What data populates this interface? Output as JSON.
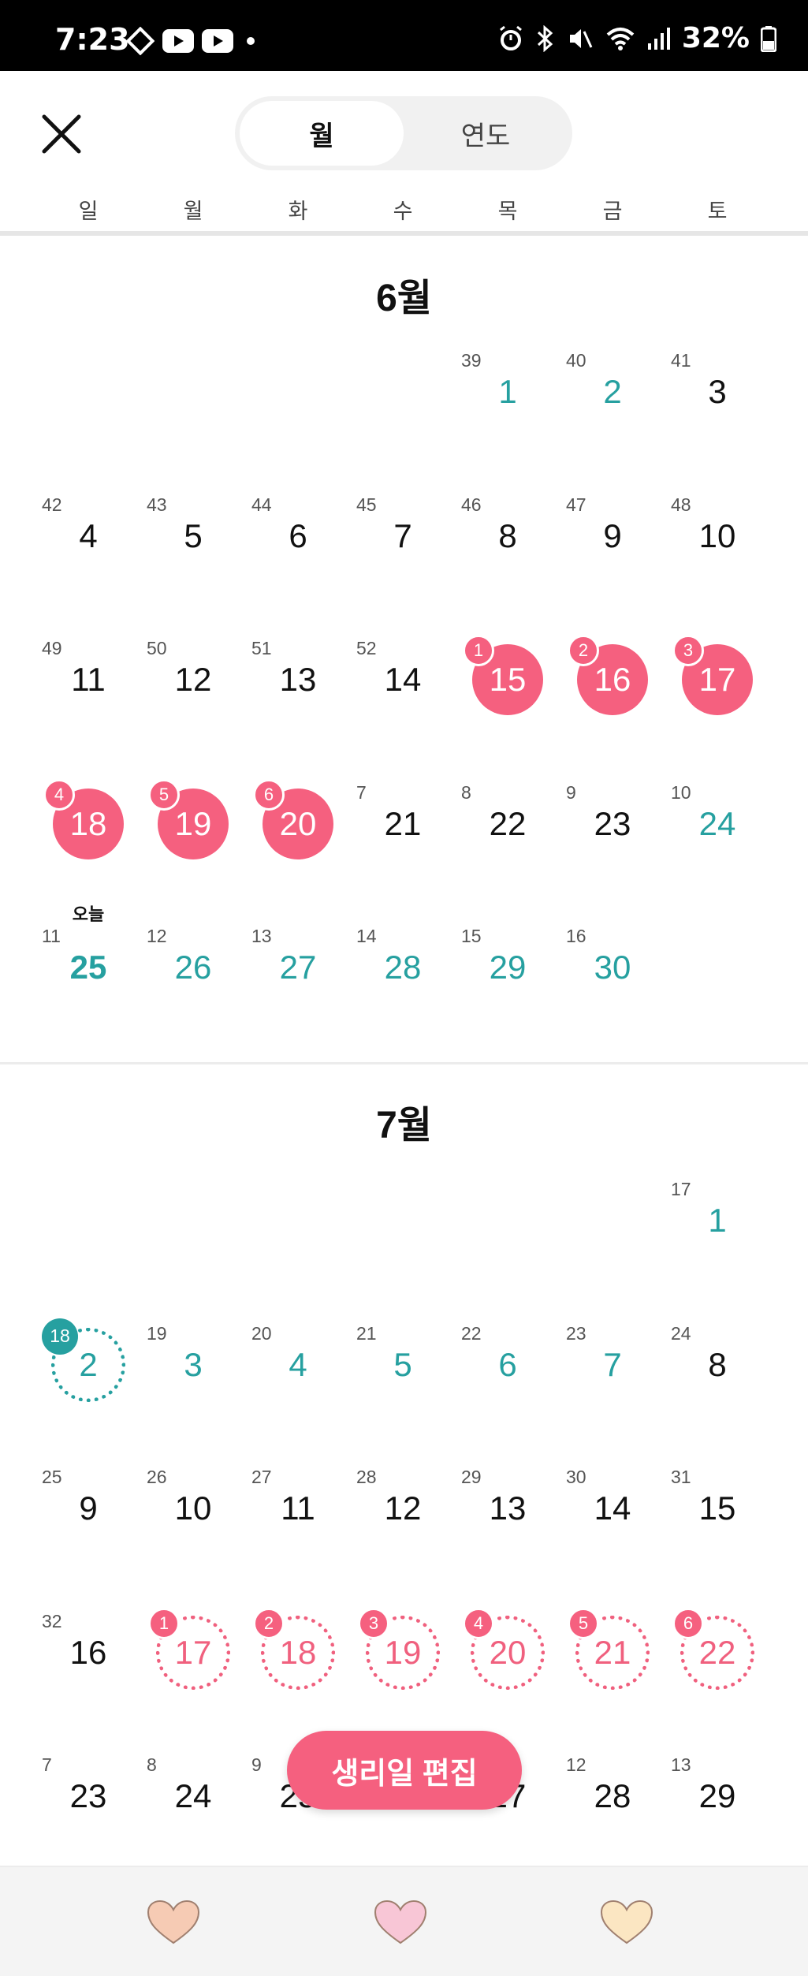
{
  "status_bar": {
    "time": "7:23",
    "battery": "32%"
  },
  "header": {
    "tabs": [
      {
        "label": "월",
        "active": true
      },
      {
        "label": "연도",
        "active": false
      }
    ],
    "weekdays": [
      "일",
      "월",
      "화",
      "수",
      "목",
      "금",
      "토"
    ]
  },
  "months": [
    {
      "title": "6월",
      "today_label": "오늘",
      "weeks": [
        [
          null,
          null,
          null,
          null,
          {
            "day": "1",
            "cycle": "39",
            "style": "teal"
          },
          {
            "day": "2",
            "cycle": "40",
            "style": "teal"
          },
          {
            "day": "3",
            "cycle": "41",
            "style": "plain"
          }
        ],
        [
          {
            "day": "4",
            "cycle": "42",
            "style": "plain"
          },
          {
            "day": "5",
            "cycle": "43",
            "style": "plain"
          },
          {
            "day": "6",
            "cycle": "44",
            "style": "plain"
          },
          {
            "day": "7",
            "cycle": "45",
            "style": "plain"
          },
          {
            "day": "8",
            "cycle": "46",
            "style": "plain"
          },
          {
            "day": "9",
            "cycle": "47",
            "style": "plain"
          },
          {
            "day": "10",
            "cycle": "48",
            "style": "plain"
          }
        ],
        [
          {
            "day": "11",
            "cycle": "49",
            "style": "plain"
          },
          {
            "day": "12",
            "cycle": "50",
            "style": "plain"
          },
          {
            "day": "13",
            "cycle": "51",
            "style": "plain"
          },
          {
            "day": "14",
            "cycle": "52",
            "style": "plain"
          },
          {
            "day": "15",
            "cycle": "1",
            "style": "period"
          },
          {
            "day": "16",
            "cycle": "2",
            "style": "period"
          },
          {
            "day": "17",
            "cycle": "3",
            "style": "period"
          }
        ],
        [
          {
            "day": "18",
            "cycle": "4",
            "style": "period"
          },
          {
            "day": "19",
            "cycle": "5",
            "style": "period"
          },
          {
            "day": "20",
            "cycle": "6",
            "style": "period"
          },
          {
            "day": "21",
            "cycle": "7",
            "style": "plain"
          },
          {
            "day": "22",
            "cycle": "8",
            "style": "plain"
          },
          {
            "day": "23",
            "cycle": "9",
            "style": "plain"
          },
          {
            "day": "24",
            "cycle": "10",
            "style": "teal"
          }
        ],
        [
          {
            "day": "25",
            "cycle": "11",
            "style": "today"
          },
          {
            "day": "26",
            "cycle": "12",
            "style": "teal"
          },
          {
            "day": "27",
            "cycle": "13",
            "style": "teal"
          },
          {
            "day": "28",
            "cycle": "14",
            "style": "teal"
          },
          {
            "day": "29",
            "cycle": "15",
            "style": "teal"
          },
          {
            "day": "30",
            "cycle": "16",
            "style": "teal"
          },
          null
        ]
      ]
    },
    {
      "title": "7월",
      "weeks": [
        [
          null,
          null,
          null,
          null,
          null,
          null,
          {
            "day": "1",
            "cycle": "17",
            "style": "teal"
          }
        ],
        [
          {
            "day": "2",
            "cycle": "18",
            "style": "ovulation"
          },
          {
            "day": "3",
            "cycle": "19",
            "style": "teal"
          },
          {
            "day": "4",
            "cycle": "20",
            "style": "teal"
          },
          {
            "day": "5",
            "cycle": "21",
            "style": "teal"
          },
          {
            "day": "6",
            "cycle": "22",
            "style": "teal"
          },
          {
            "day": "7",
            "cycle": "23",
            "style": "teal"
          },
          {
            "day": "8",
            "cycle": "24",
            "style": "plain"
          }
        ],
        [
          {
            "day": "9",
            "cycle": "25",
            "style": "plain"
          },
          {
            "day": "10",
            "cycle": "26",
            "style": "plain"
          },
          {
            "day": "11",
            "cycle": "27",
            "style": "plain"
          },
          {
            "day": "12",
            "cycle": "28",
            "style": "plain"
          },
          {
            "day": "13",
            "cycle": "29",
            "style": "plain"
          },
          {
            "day": "14",
            "cycle": "30",
            "style": "plain"
          },
          {
            "day": "15",
            "cycle": "31",
            "style": "plain"
          }
        ],
        [
          {
            "day": "16",
            "cycle": "32",
            "style": "plain"
          },
          {
            "day": "17",
            "cycle": "1",
            "style": "predicted"
          },
          {
            "day": "18",
            "cycle": "2",
            "style": "predicted"
          },
          {
            "day": "19",
            "cycle": "3",
            "style": "predicted"
          },
          {
            "day": "20",
            "cycle": "4",
            "style": "predicted"
          },
          {
            "day": "21",
            "cycle": "5",
            "style": "predicted"
          },
          {
            "day": "22",
            "cycle": "6",
            "style": "predicted"
          }
        ],
        [
          {
            "day": "23",
            "cycle": "7",
            "style": "plain"
          },
          {
            "day": "24",
            "cycle": "8",
            "style": "plain"
          },
          {
            "day": "25",
            "cycle": "9",
            "style": "plain"
          },
          {
            "day": "26",
            "cycle": "10",
            "style": "plain"
          },
          {
            "day": "27",
            "cycle": "11",
            "style": "plain"
          },
          {
            "day": "28",
            "cycle": "12",
            "style": "plain"
          },
          {
            "day": "29",
            "cycle": "13",
            "style": "plain"
          }
        ]
      ]
    }
  ],
  "edit_button": {
    "label": "생리일 편집"
  },
  "bottom_nav": [
    {
      "icon": "heart-icon",
      "color": "#f6cbb4"
    },
    {
      "icon": "heart-icon",
      "color": "#f8c6d6"
    },
    {
      "icon": "heart-icon",
      "color": "#fbe6c2"
    }
  ],
  "colors": {
    "accent_pink": "#f5607f",
    "accent_teal": "#26a0a0"
  }
}
